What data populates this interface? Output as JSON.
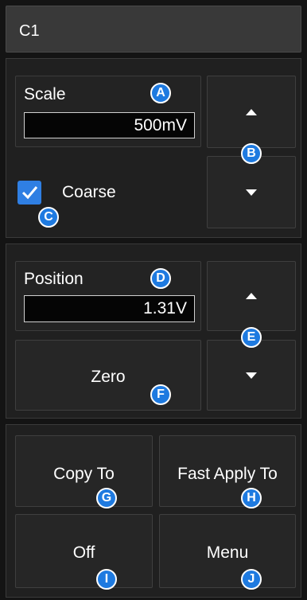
{
  "header": {
    "title": "C1"
  },
  "scale": {
    "label": "Scale",
    "value": "500mV"
  },
  "coarse": {
    "label": "Coarse",
    "checked": true
  },
  "position": {
    "label": "Position",
    "value": "1.31V"
  },
  "zero": {
    "label": "Zero"
  },
  "buttons": {
    "copy_to": "Copy To",
    "fast_apply_to": "Fast Apply To",
    "off": "Off",
    "menu": "Menu"
  },
  "badges": {
    "a": "A",
    "b": "B",
    "c": "C",
    "d": "D",
    "e": "E",
    "f": "F",
    "g": "G",
    "h": "H",
    "i": "I",
    "j": "J"
  },
  "icons": {
    "scale_up": "up-arrow-icon",
    "scale_down": "down-arrow-icon",
    "position_up": "up-arrow-icon",
    "position_down": "down-arrow-icon",
    "check": "checkmark-icon"
  },
  "colors": {
    "accent": "#2f7fe3",
    "badge": "#1e7ae0",
    "background": "#141414"
  }
}
